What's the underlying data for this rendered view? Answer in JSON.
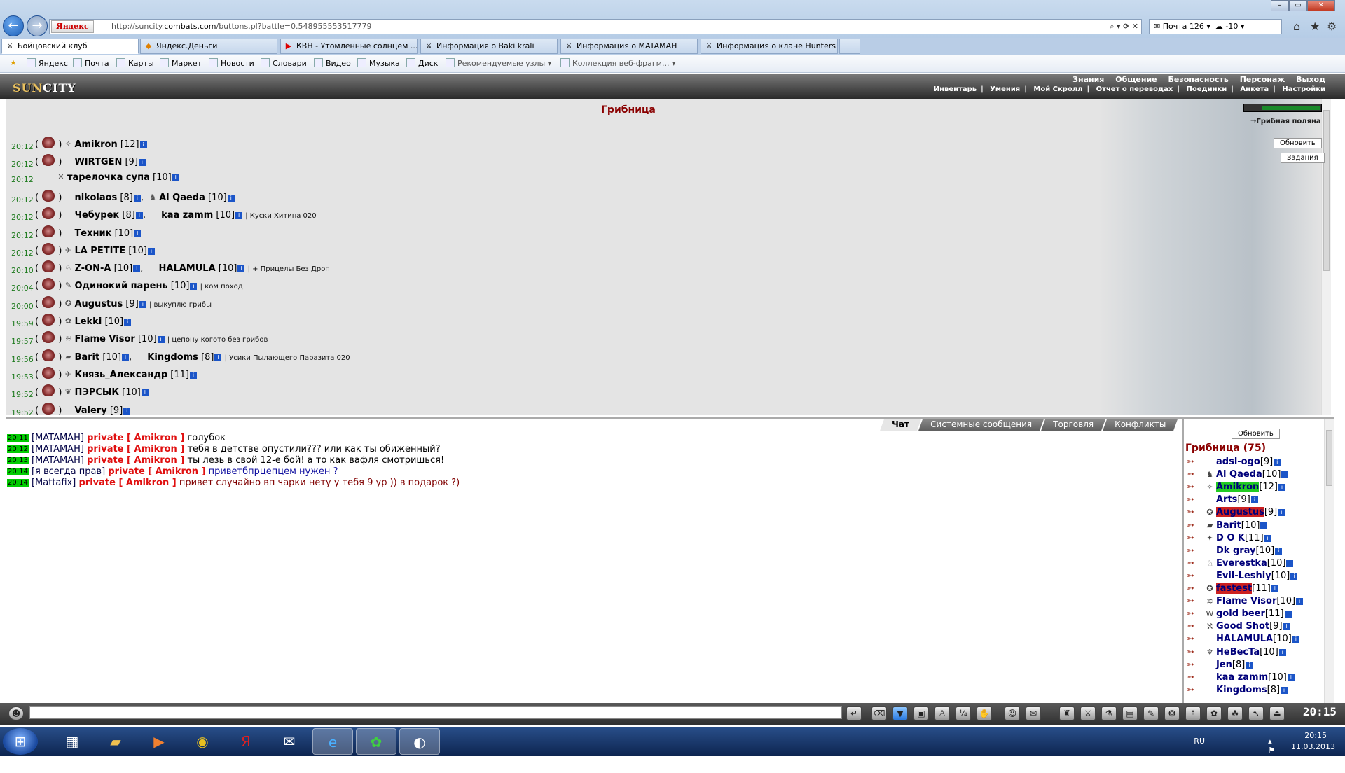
{
  "browser": {
    "search_brand": "Яндекс",
    "url_prefix": "http://suncity.",
    "url_domain": "combats.com",
    "url_rest": "/buttons.pl?battle=0.548955553517779",
    "mail": "Почта 126",
    "weather": "-10",
    "tabs": [
      {
        "label": "Бойцовский клуб",
        "icon": "crossed-swords-icon",
        "active": true
      },
      {
        "label": "Яндекс.Деньги",
        "icon": "yandex-money-icon",
        "active": false
      },
      {
        "label": "КВН - Утомленные солнцем ...",
        "icon": "youtube-icon",
        "active": false
      },
      {
        "label": "Информация о Baki krali",
        "icon": "crossed-swords-icon",
        "active": false
      },
      {
        "label": "Информация о MATAMAH",
        "icon": "crossed-swords-icon",
        "active": false
      },
      {
        "label": "Информация о клане Hunters",
        "icon": "crossed-swords-icon",
        "active": false
      }
    ],
    "favorites": [
      "Яндекс",
      "Почта",
      "Карты",
      "Маркет",
      "Новости",
      "Словари",
      "Видео",
      "Музыка",
      "Диск",
      "Рекомендуемые узлы ▾",
      "Коллекция веб-фрагм... ▾"
    ]
  },
  "game": {
    "logo_left": "SUN",
    "logo_right": "CITY",
    "menu_top": [
      "Знания",
      "Общение",
      "Безопасность",
      "Персонаж",
      "Выход"
    ],
    "menu_sub": [
      "Инвентарь",
      "Умения",
      "Мой Скролл",
      "Отчет о переводах",
      "Поединки",
      "Анкета",
      "Настройки"
    ],
    "room_title": "Грибница",
    "location": "Грибная поляна",
    "refresh_label": "Обновить",
    "tasks_label": "Задания",
    "room_rows": [
      {
        "time": "20:12",
        "players": [
          {
            "name": "Amikron",
            "level": "[12]",
            "clan": "✧"
          }
        ],
        "note": ""
      },
      {
        "time": "20:12",
        "players": [
          {
            "name": "WIRTGEN",
            "level": "[9]",
            "clan": ""
          }
        ],
        "note": ""
      },
      {
        "time": "20:12",
        "players": [
          {
            "name": "тарелочка супа",
            "level": "[10]",
            "clan": "✕"
          }
        ],
        "note": "",
        "indent": true
      },
      {
        "time": "20:12",
        "players": [
          {
            "name": "nikolaos",
            "level": "[8]",
            "clan": ""
          },
          {
            "name": "Al Qaeda",
            "level": "[10]",
            "clan": "♞"
          }
        ],
        "note": ""
      },
      {
        "time": "20:12",
        "players": [
          {
            "name": "Чебурек",
            "level": "[8]",
            "clan": ""
          },
          {
            "name": "kaa zamm",
            "level": "[10]",
            "clan": ""
          }
        ],
        "note": "Куски Хитина 020"
      },
      {
        "time": "20:12",
        "players": [
          {
            "name": "Техник",
            "level": "[10]",
            "clan": ""
          }
        ],
        "note": ""
      },
      {
        "time": "20:12",
        "players": [
          {
            "name": "LA PETITE",
            "level": "[10]",
            "clan": "✈"
          }
        ],
        "note": ""
      },
      {
        "time": "20:10",
        "players": [
          {
            "name": "Z-ON-A",
            "level": "[10]",
            "clan": "♘"
          },
          {
            "name": "HALAMULA",
            "level": "[10]",
            "clan": ""
          }
        ],
        "note": "+ Прицелы Без Дроп"
      },
      {
        "time": "20:04",
        "players": [
          {
            "name": "Одинокий парень",
            "level": "[10]",
            "clan": "✎"
          }
        ],
        "note": "ком поход"
      },
      {
        "time": "20:00",
        "players": [
          {
            "name": "Augustus",
            "level": "[9]",
            "clan": "✪"
          }
        ],
        "note": "выкуплю грибы"
      },
      {
        "time": "19:59",
        "players": [
          {
            "name": "Lekki",
            "level": "[10]",
            "clan": "✿"
          }
        ],
        "note": ""
      },
      {
        "time": "19:57",
        "players": [
          {
            "name": "Flame Visor",
            "level": "[10]",
            "clan": "≋"
          }
        ],
        "note": "цепону когото без грибов"
      },
      {
        "time": "19:56",
        "players": [
          {
            "name": "Barit",
            "level": "[10]",
            "clan": "▰"
          },
          {
            "name": "Kingdoms",
            "level": "[8]",
            "clan": ""
          }
        ],
        "note": "Усики Пылающего Паразита 020"
      },
      {
        "time": "19:53",
        "players": [
          {
            "name": "Князь_Александр",
            "level": "[11]",
            "clan": "✈"
          }
        ],
        "note": ""
      },
      {
        "time": "19:52",
        "players": [
          {
            "name": "ПЭРСЫК",
            "level": "[10]",
            "clan": "❦"
          }
        ],
        "note": ""
      },
      {
        "time": "19:52",
        "players": [
          {
            "name": "Valery",
            "level": "[9]",
            "clan": ""
          }
        ],
        "note": ""
      }
    ]
  },
  "chat": {
    "tabs": [
      "Чат",
      "Системные сообщения",
      "Торговля",
      "Конфликты"
    ],
    "messages": [
      {
        "time": "20:11",
        "from": "[MATAMAH]",
        "priv": "private [ Amikron ]",
        "text": "голубок",
        "style": "txt"
      },
      {
        "time": "20:12",
        "from": "[MATAMAH]",
        "priv": "private [ Amikron ]",
        "text": "тебя в детстве опустили??? или как ты обиженный?",
        "style": "txt"
      },
      {
        "time": "20:13",
        "from": "[MATAMAH]",
        "priv": "private [ Amikron ]",
        "text": "ты лезь в свой 12-е бой! а то как вафля смотришься!",
        "style": "txt"
      },
      {
        "time": "20:14",
        "from": "[я всегда прав]",
        "priv": "private [ Amikron ]",
        "text": "приветбпрцепцем нужен ?",
        "style": "blue"
      },
      {
        "time": "20:14",
        "from": "[Mattafix]",
        "priv": "private [ Amikron ]",
        "text": "привет случайно вп чарки нету у тебя 9 ур )) в подарок ?)",
        "style": "dred"
      }
    ]
  },
  "userlist": {
    "refresh_label": "Обновить",
    "title": "Грибница (75)",
    "users": [
      {
        "name": "adsl-ogo",
        "level": "[9]",
        "clan": "",
        "hl": ""
      },
      {
        "name": "Al Qaeda",
        "level": "[10]",
        "clan": "♞",
        "hl": ""
      },
      {
        "name": "Amikron",
        "level": "[12]",
        "clan": "✧",
        "hl": "green"
      },
      {
        "name": "Arts",
        "level": "[9]",
        "clan": "",
        "hl": ""
      },
      {
        "name": "Augustus",
        "level": "[9]",
        "clan": "✪",
        "hl": "red"
      },
      {
        "name": "Barit",
        "level": "[10]",
        "clan": "▰",
        "hl": ""
      },
      {
        "name": "D O K",
        "level": "[11]",
        "clan": "✦",
        "hl": ""
      },
      {
        "name": "Dk gray",
        "level": "[10]",
        "clan": "",
        "hl": ""
      },
      {
        "name": "Everestka",
        "level": "[10]",
        "clan": "♘",
        "hl": ""
      },
      {
        "name": "Evil-Leshiy",
        "level": "[10]",
        "clan": "",
        "hl": ""
      },
      {
        "name": "fastest",
        "level": "[11]",
        "clan": "✪",
        "hl": "red"
      },
      {
        "name": "Flame Visor",
        "level": "[10]",
        "clan": "≋",
        "hl": ""
      },
      {
        "name": "gold beer",
        "level": "[11]",
        "clan": "W",
        "hl": ""
      },
      {
        "name": "Good Shot",
        "level": "[9]",
        "clan": "ℵ",
        "hl": ""
      },
      {
        "name": "HALAMULA",
        "level": "[10]",
        "clan": "",
        "hl": ""
      },
      {
        "name": "HeBecTa",
        "level": "[10]",
        "clan": "♆",
        "hl": ""
      },
      {
        "name": "Jen",
        "level": "[8]",
        "clan": "",
        "hl": ""
      },
      {
        "name": "kaa zamm",
        "level": "[10]",
        "clan": "",
        "hl": ""
      },
      {
        "name": "Kingdoms",
        "level": "[8]",
        "clan": "",
        "hl": ""
      }
    ]
  },
  "clock": "20:15",
  "tray": {
    "lang": "RU",
    "time": "20:15",
    "date": "11.03.2013"
  }
}
